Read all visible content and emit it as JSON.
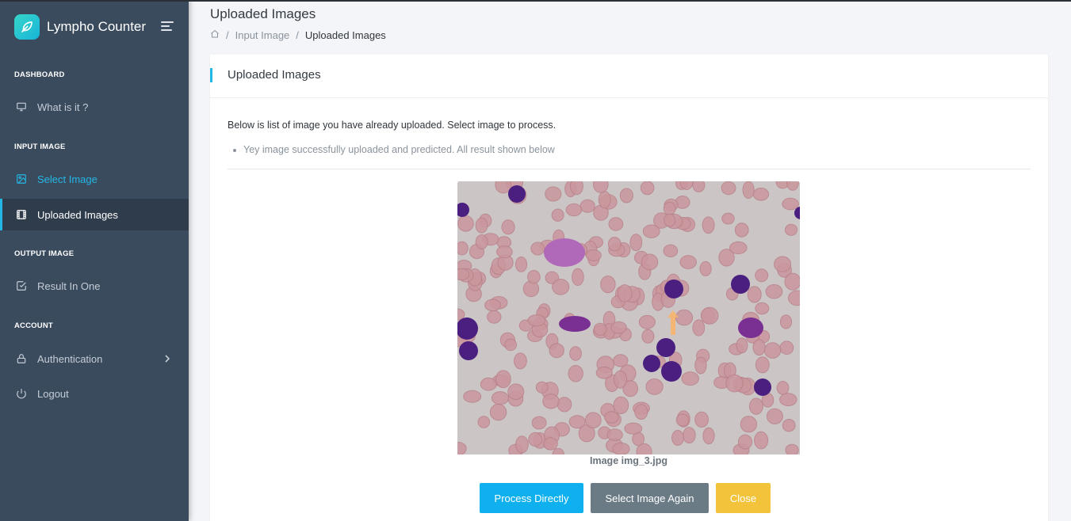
{
  "app": {
    "name": "Lympho Counter"
  },
  "sidebar": {
    "sections": [
      {
        "title": "DASHBOARD"
      },
      {
        "title": "INPUT IMAGE"
      },
      {
        "title": "OUTPUT IMAGE"
      },
      {
        "title": "ACCOUNT"
      }
    ],
    "items": [
      {
        "label": "What is it ?",
        "icon": "monitor-icon"
      },
      {
        "label": "Select Image",
        "icon": "image-icon",
        "state": "active"
      },
      {
        "label": "Uploaded Images",
        "icon": "film-icon",
        "state": "selected"
      },
      {
        "label": "Result In One",
        "icon": "check-square-icon"
      },
      {
        "label": "Authentication",
        "icon": "lock-icon",
        "has_submenu": true
      },
      {
        "label": "Logout",
        "icon": "power-icon"
      }
    ]
  },
  "header": {
    "title": "Uploaded Images",
    "breadcrumb": [
      {
        "label": "home",
        "icon": "home-icon"
      },
      {
        "label": "Input Image"
      },
      {
        "label": "Uploaded Images"
      }
    ]
  },
  "card": {
    "title": "Uploaded Images",
    "intro": "Below is list of image you have already uploaded. Select image to process.",
    "notice": "Yey image successfully uploaded and predicted. All result shown below",
    "image_caption": "Image img_3.jpg",
    "buttons": {
      "process": "Process Directly",
      "select_again": "Select Image Again",
      "close": "Close"
    }
  },
  "colors": {
    "sidebar_bg": "#3b4b5e",
    "accent": "#23b7e5",
    "primary_button": "#0fb0ee",
    "secondary_button": "#6b7b86",
    "warning_button": "#f3c33b"
  }
}
